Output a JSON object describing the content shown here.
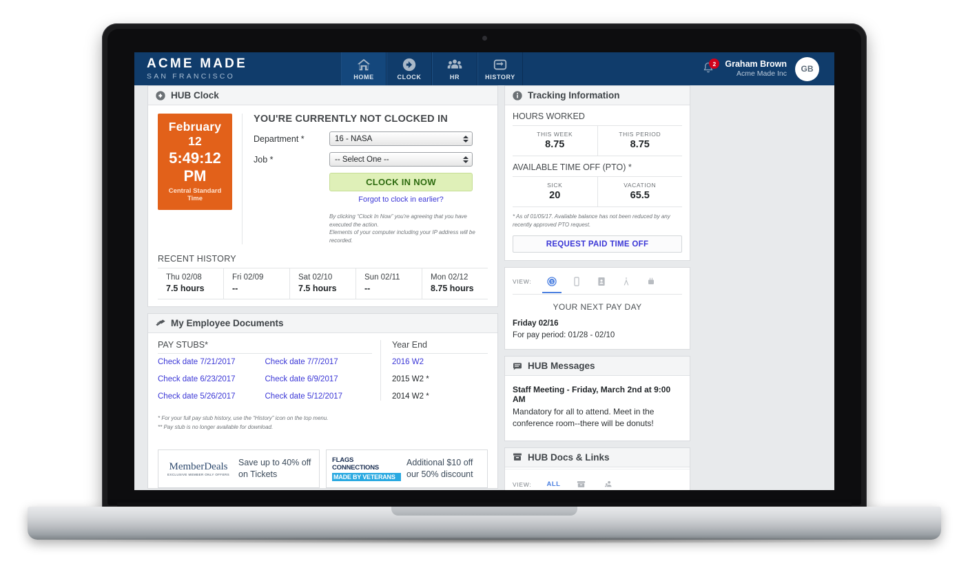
{
  "header": {
    "brand_main": "ACME MADE",
    "brand_sub": "SAN FRANCISCO",
    "nav": [
      {
        "label": "HOME",
        "icon": "home-icon",
        "active": true
      },
      {
        "label": "CLOCK",
        "icon": "clock-icon",
        "active": false
      },
      {
        "label": "HR",
        "icon": "people-icon",
        "active": false
      },
      {
        "label": "HISTORY",
        "icon": "wallet-icon",
        "active": false
      }
    ],
    "notification_count": "2",
    "user_name": "Graham Brown",
    "user_org": "Acme Made Inc",
    "avatar_initials": "GB"
  },
  "hub_clock": {
    "panel_title": "HUB Clock",
    "date": "February 12",
    "time": "5:49:12 PM",
    "timezone": "Central Standard Time",
    "status": "YOU'RE CURRENTLY NOT CLOCKED IN",
    "department_label": "Department *",
    "department_value": "16 - NASA",
    "job_label": "Job *",
    "job_value": "-- Select One --",
    "clock_in_button": "CLOCK IN NOW",
    "forgot_link": "Forgot to clock in earlier?",
    "disclaimer_line1": "By clicking “Clock In Now” you're agreeing that you have executed the action.",
    "disclaimer_line2": "Elements of your computer including your IP address will be recorded.",
    "recent_history_title": "RECENT HISTORY",
    "recent_history": [
      {
        "day": "Thu 02/08",
        "value": "7.5 hours"
      },
      {
        "day": "Fri 02/09",
        "value": "--"
      },
      {
        "day": "Sat 02/10",
        "value": "7.5 hours"
      },
      {
        "day": "Sun 02/11",
        "value": "--"
      },
      {
        "day": "Mon 02/12",
        "value": "8.75 hours"
      }
    ]
  },
  "documents": {
    "panel_title": "My Employee Documents",
    "pay_stubs_title": "PAY STUBS*",
    "year_end_title": "Year End",
    "pay_stubs": [
      "Check date 7/21/2017",
      "Check date 7/7/2017",
      "Check date 6/23/2017",
      "Check date 6/9/2017",
      "Check date 5/26/2017",
      "Check date 5/12/2017"
    ],
    "year_end": [
      {
        "label": "2016 W2",
        "link": true
      },
      {
        "label": "2015 W2 *",
        "link": false
      },
      {
        "label": "2014 W2 *",
        "link": false
      }
    ],
    "footnote_line1": "* For your full pay stub history, use the “History” icon on the top menu.",
    "footnote_line2": "** Pay stub is no longer available for download."
  },
  "ads": [
    {
      "logo_main": "MemberDeals",
      "logo_sub": "EXCLUSIVE MEMBER ONLY OFFERS",
      "text_line1": "Save up to 40% off",
      "text_line2": "on Tickets"
    },
    {
      "logo_main": "FLAGS CONNECTIONS",
      "logo_sub": "MADE BY VETERANS",
      "text_line1": "Additional $10 off",
      "text_line2": "our 50% discount"
    }
  ],
  "tracking": {
    "panel_title": "Tracking Information",
    "hours_worked_label": "HOURS WORKED",
    "hours_worked": [
      {
        "key": "THIS WEEK",
        "value": "8.75"
      },
      {
        "key": "THIS PERIOD",
        "value": "8.75"
      }
    ],
    "pto_label": "AVAILABLE TIME OFF (PTO) *",
    "pto": [
      {
        "key": "SICK",
        "value": "20"
      },
      {
        "key": "VACATION",
        "value": "65.5"
      }
    ],
    "note_line1": "* As of 01/05/17. Available balance has not been reduced by any",
    "note_line2": "recently approved PTO request.",
    "pto_button": "REQUEST PAID TIME OFF"
  },
  "payday": {
    "view_label": "VIEW:",
    "view_tabs": [
      {
        "icon": "dollar-coin-icon",
        "active": true
      },
      {
        "icon": "phone-icon",
        "active": false
      },
      {
        "icon": "contact-card-icon",
        "active": false
      },
      {
        "icon": "person-icon",
        "active": false
      },
      {
        "icon": "device-icon",
        "active": false
      }
    ],
    "title": "YOUR NEXT PAY DAY",
    "date": "Friday 02/16",
    "period": "For pay period: 01/28 - 02/10"
  },
  "messages": {
    "panel_title": "HUB Messages",
    "message_title": "Staff Meeting - Friday, March 2nd at 9:00 AM",
    "message_line1": "Mandatory for all to attend. Meet in the",
    "message_line2": "conference room--there will be donuts!"
  },
  "docs_links": {
    "panel_title": "HUB Docs & Links",
    "view_label": "VIEW:",
    "tabs": [
      {
        "label": "ALL",
        "icon": null,
        "active": true
      },
      {
        "label": null,
        "icon": "archive-icon",
        "active": false
      },
      {
        "label": null,
        "icon": "people2-icon",
        "active": false
      }
    ]
  },
  "colors": {
    "header_blue": "#103c6b",
    "clock_orange": "#E2611A",
    "link_blue": "#3a36d6",
    "accent_blue": "#4a7fe0",
    "button_green_bg": "#dff0b8",
    "badge_red": "#d0021b"
  }
}
